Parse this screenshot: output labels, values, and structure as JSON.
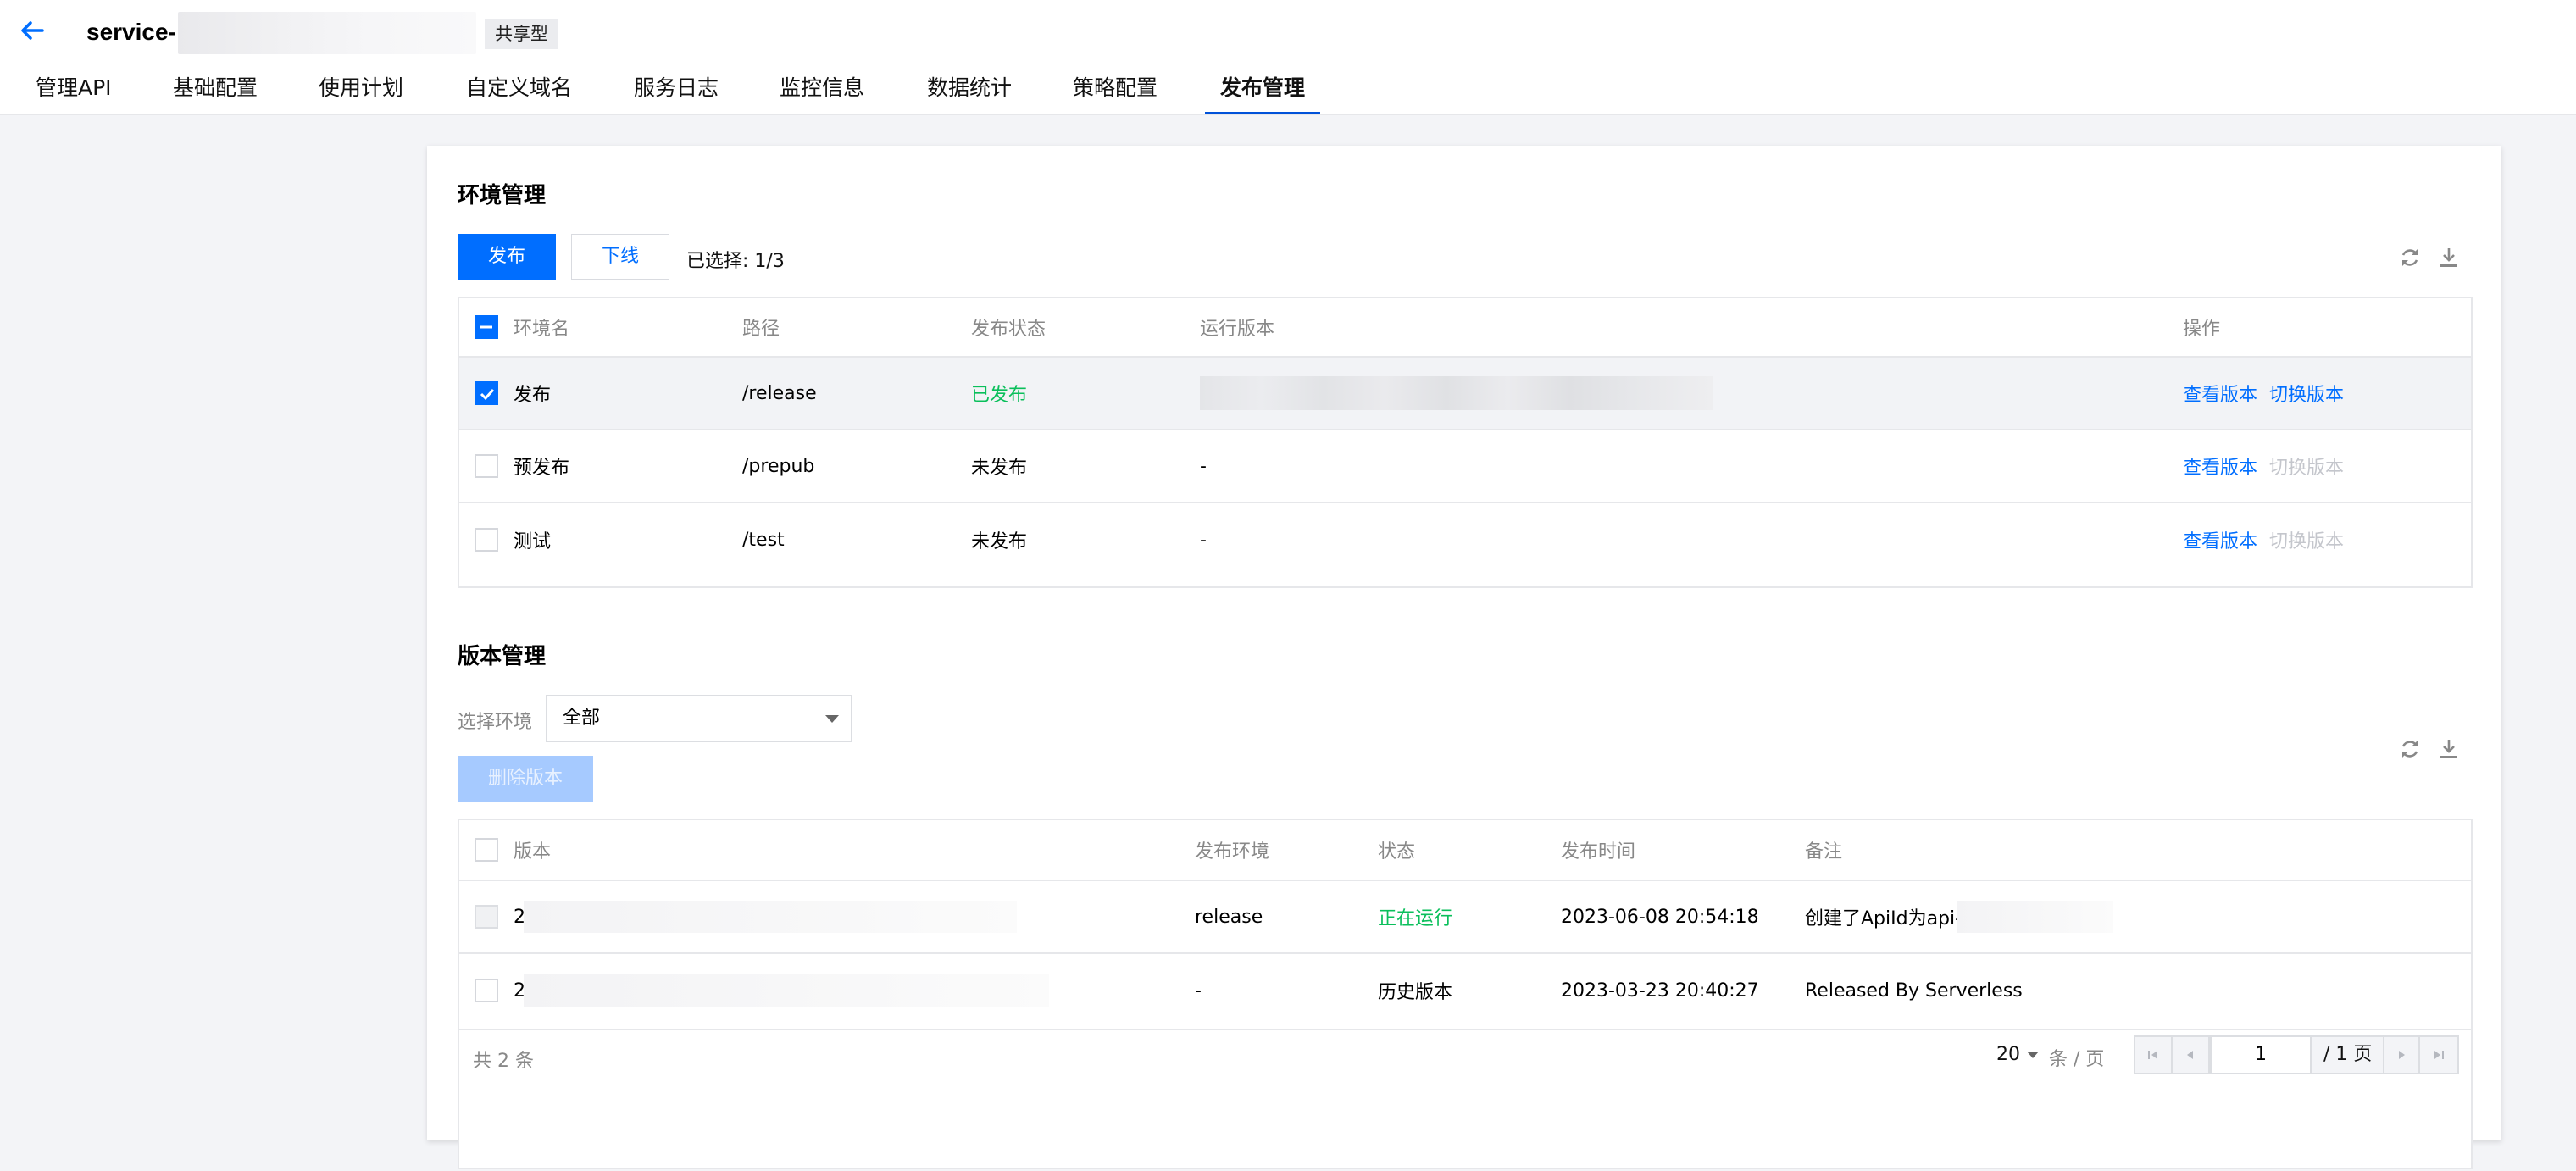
{
  "header": {
    "service_name": "service-",
    "type_badge": "共享型",
    "tabs": [
      {
        "label": "管理API"
      },
      {
        "label": "基础配置"
      },
      {
        "label": "使用计划"
      },
      {
        "label": "自定义域名"
      },
      {
        "label": "服务日志"
      },
      {
        "label": "监控信息"
      },
      {
        "label": "数据统计"
      },
      {
        "label": "策略配置"
      },
      {
        "label": "发布管理",
        "active": true
      }
    ]
  },
  "env": {
    "title": "环境管理",
    "publish_button": "发布",
    "offline_button": "下线",
    "selected_text": "已选择: 1/3",
    "columns": [
      "环境名",
      "路径",
      "发布状态",
      "运行版本",
      "操作"
    ],
    "rows": [
      {
        "name": "发布",
        "path": "/release",
        "status": "已发布",
        "version": "",
        "view_action": "查看版本",
        "switch_action": "切换版本",
        "checked": true
      },
      {
        "name": "预发布",
        "path": "/prepub",
        "status": "未发布",
        "version": "-",
        "view_action": "查看版本",
        "switch_action": "切换版本",
        "checked": false
      },
      {
        "name": "测试",
        "path": "/test",
        "status": "未发布",
        "version": "-",
        "view_action": "查看版本",
        "switch_action": "切换版本",
        "checked": false
      }
    ]
  },
  "versions": {
    "title": "版本管理",
    "filter_label": "选择环境",
    "filter_value": "全部",
    "delete_button": "删除版本",
    "columns": [
      "版本",
      "发布环境",
      "状态",
      "发布时间",
      "备注"
    ],
    "rows": [
      {
        "version": "2",
        "env": "release",
        "status": "正在运行",
        "time": "2023-06-08 20:54:18",
        "note": "创建了ApiId为api-"
      },
      {
        "version": "2",
        "env": "-",
        "status": "历史版本",
        "time": "2023-03-23 20:40:27",
        "note": "Released By Serverless"
      }
    ],
    "total_text": "共 2 条",
    "page_size": "20",
    "per_page_label": "条 / 页",
    "current_page": "1",
    "total_pages_text": "/ 1 页"
  },
  "colors": {
    "primary": "#006eff",
    "success": "#0abf5b",
    "active_tab": "#0052d9"
  }
}
